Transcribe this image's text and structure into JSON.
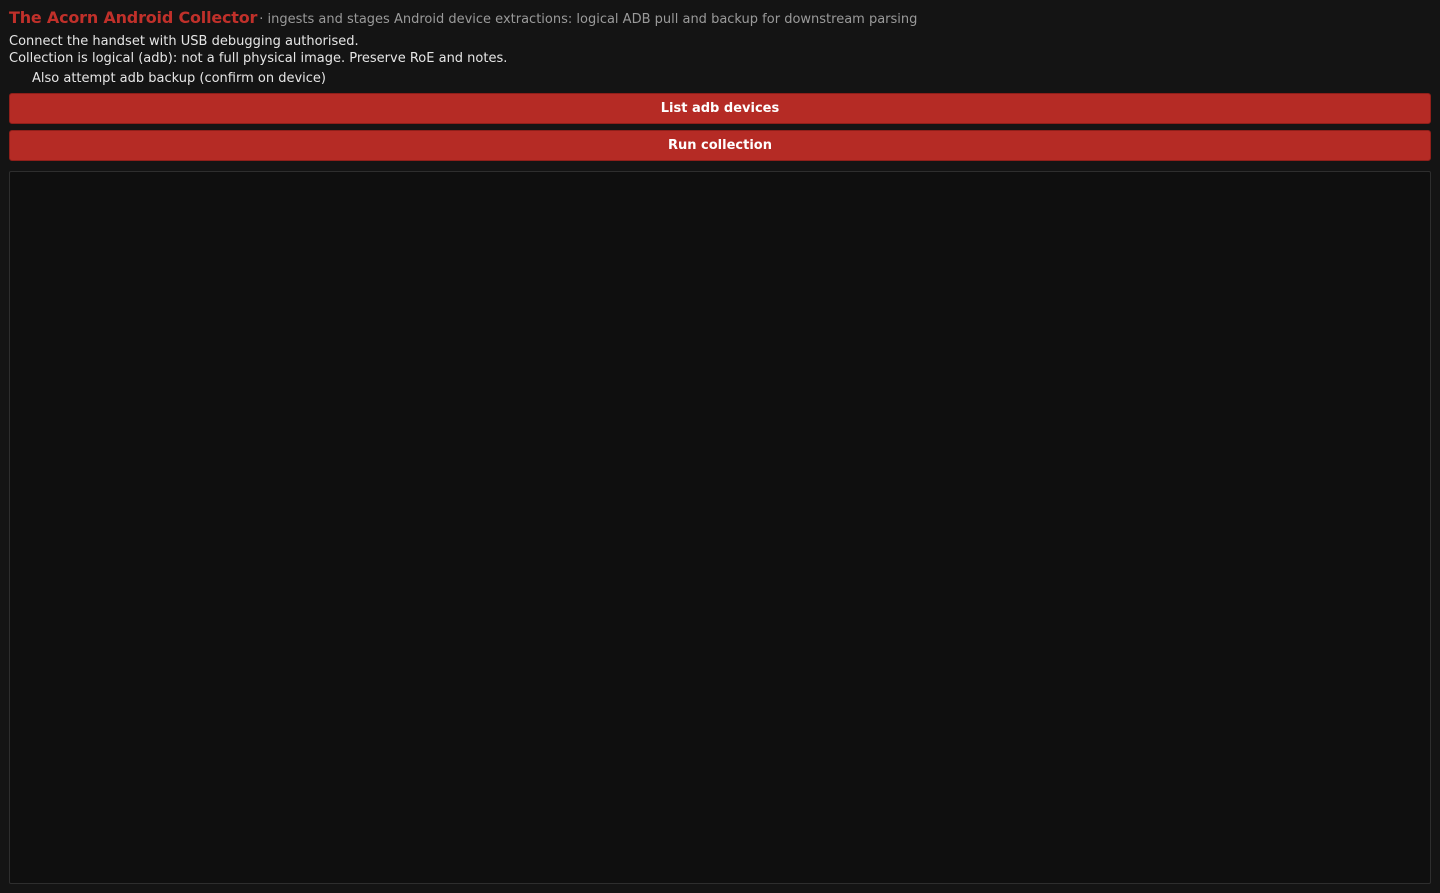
{
  "header": {
    "title": "The Acorn Android Collector",
    "subtitle": "· ingests and stages Android device extractions: logical ADB pull and backup for downstream parsing"
  },
  "notes": {
    "line1": "Connect the handset with USB debugging authorised.",
    "line2": "Collection is logical (adb): not a full physical image. Preserve RoE and notes."
  },
  "options": {
    "backup_label": "Also attempt adb backup (confirm on device)",
    "backup_checked": false
  },
  "actions": {
    "list_devices_label": "List adb devices",
    "run_collection_label": "Run collection"
  },
  "output": {
    "text": ""
  },
  "colors": {
    "accent": "#c0302a",
    "button_bg": "#b52b25",
    "background": "#141414",
    "panel_bg": "#0f0f0f"
  }
}
